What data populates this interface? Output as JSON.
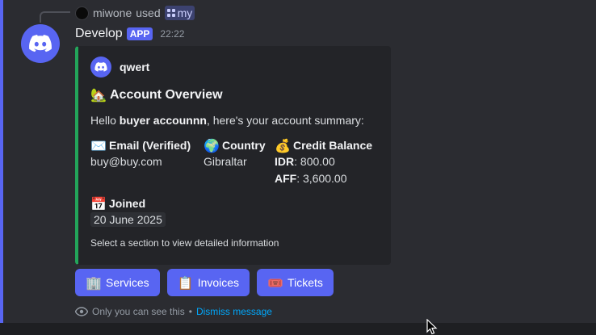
{
  "reply": {
    "user": "miwone",
    "used": "used",
    "command": "my"
  },
  "message": {
    "username": "Develop",
    "badge": "APP",
    "timestamp": "22:22"
  },
  "embed": {
    "author": "qwert",
    "title_icon": "🏡",
    "title": "Account Overview",
    "desc_prefix": "Hello ",
    "desc_user": "buyer accounnn",
    "desc_suffix": ", here's your account summary:",
    "fields": {
      "email": {
        "icon": "✉️",
        "name": "Email (Verified)",
        "value": "buy@buy.com"
      },
      "country": {
        "icon": "🌍",
        "name": "Country",
        "value": "Gibraltar"
      },
      "balance": {
        "icon": "💰",
        "name": "Credit Balance",
        "lines": [
          {
            "currency": "IDR",
            "amount": ": 800.00"
          },
          {
            "currency": "AFF",
            "amount": ": 3,600.00"
          }
        ]
      },
      "joined": {
        "icon": "📅",
        "name": "Joined",
        "value": "20 June 2025"
      }
    },
    "footer": "Select a section to view detailed information"
  },
  "buttons": [
    {
      "icon": "🏢",
      "label": "Services"
    },
    {
      "icon": "📋",
      "label": "Invoices"
    },
    {
      "icon": "🎟️",
      "label": "Tickets"
    }
  ],
  "ephemeral": {
    "text": "Only you can see this",
    "separator": "•",
    "dismiss": "Dismiss message"
  },
  "colors": {
    "accent": "#5865f2",
    "embed_bar": "#23a55a",
    "link": "#00a8fc"
  }
}
